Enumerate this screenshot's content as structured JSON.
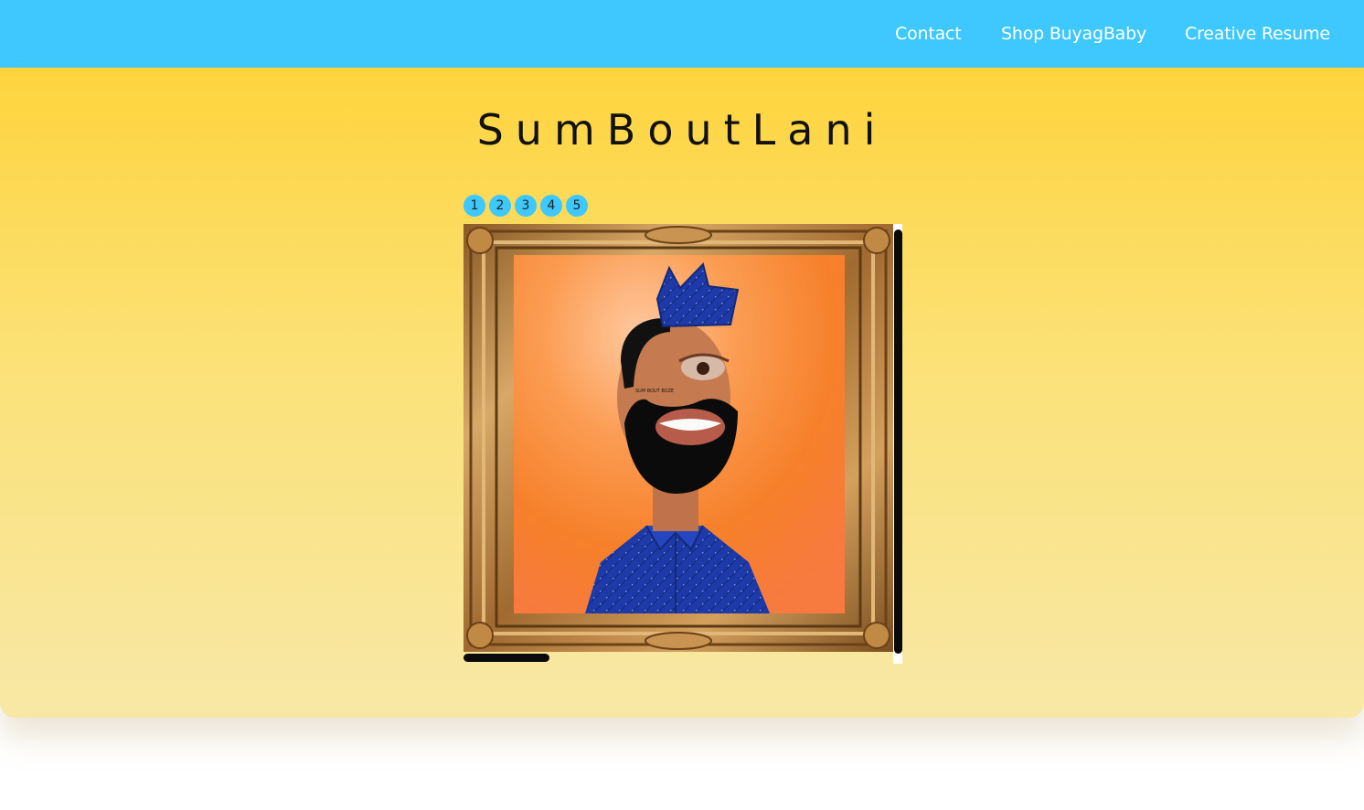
{
  "nav": {
    "contact": "Contact",
    "shop": "Shop BuyagBaby",
    "resume": "Creative Resume"
  },
  "hero": {
    "title": "SumBoutLani"
  },
  "gallery": {
    "slides": [
      "1",
      "2",
      "3",
      "4",
      "5"
    ],
    "artwork_tattoo_text": "SUM BOUT BOZE"
  },
  "colors": {
    "nav_bg": "#3ec8fd",
    "hero_top": "#fed43d",
    "hero_bottom": "#f8e8a6",
    "dot_bg": "#3ec8fd",
    "frame_gold": "#b07a3a",
    "painting_orange": "#f7852e",
    "bandana_blue": "#1d3aa8"
  }
}
